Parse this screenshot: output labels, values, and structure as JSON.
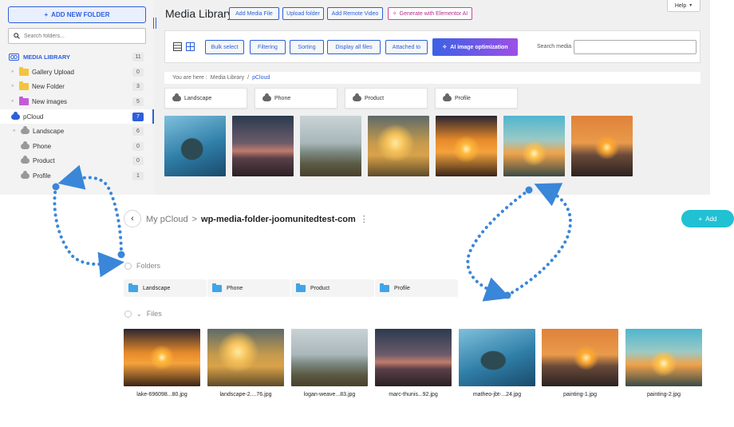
{
  "sidebar": {
    "add_folder_label": "ADD NEW FOLDER",
    "search_placeholder": "Search folders...",
    "library_label": "MEDIA LIBRARY",
    "library_count": "11",
    "items": [
      {
        "label": "Gallery Upload",
        "count": "0"
      },
      {
        "label": "New Folder",
        "count": "3"
      },
      {
        "label": "New images",
        "count": "5"
      },
      {
        "label": "pCloud",
        "count": "7"
      },
      {
        "label": "Landscape",
        "count": "6"
      },
      {
        "label": "Phone",
        "count": "0"
      },
      {
        "label": "Product",
        "count": "0"
      },
      {
        "label": "Profile",
        "count": "1"
      }
    ]
  },
  "header": {
    "title": "Media Library",
    "add_media": "Add Media File",
    "upload_folder": "Upload folder",
    "add_remote": "Add Remote Video",
    "elementor": "Generate with Elementor AI",
    "help": "Help"
  },
  "toolbar": {
    "bulk_select": "Bulk select",
    "filtering": "Filtering",
    "sorting": "Sorting",
    "display_all": "Display all files",
    "attached": "Attached to",
    "ai_opt": "AI image optimization",
    "search_label": "Search media"
  },
  "breadcrumb": {
    "prefix": "You are here :",
    "root": "Media Library",
    "sep": "/",
    "current": "pCloud"
  },
  "wp_folders": [
    "Landscape",
    "Phone",
    "Product",
    "Profile"
  ],
  "pcloud": {
    "crumb_root": "My pCloud",
    "crumb_sep": ">",
    "crumb_current": "wp-media-folder-joomunitedtest-com",
    "crumb_menu": "⋮",
    "add_label": "Add",
    "folders_heading": "Folders",
    "files_heading": "Files",
    "folders": [
      "Landscape",
      "Phone",
      "Product",
      "Profile"
    ],
    "files": [
      "lake-696098...80.jpg",
      "landscape-2....76.jpg",
      "logan-weave...83.jpg",
      "marc-thunis...92.jpg",
      "matheo-jbt-...24.jpg",
      "painting-1.jpg",
      "painting-2.jpg"
    ]
  },
  "colors": {
    "accent": "#2c5fdc",
    "pcloud_teal": "#20c1d3",
    "arrow_blue": "#3a86d9"
  },
  "icons": {
    "media_library": "cloud-logo-icon",
    "folder": "folder-icon",
    "cloud": "cloud-icon",
    "search": "search-icon",
    "plus": "plus-icon",
    "chevron_left": "chevron-left-icon",
    "list_view": "list-view-icon",
    "grid_view": "grid-view-icon",
    "sparkle": "sparkle-icon",
    "dropdown": "chevron-down-icon"
  }
}
